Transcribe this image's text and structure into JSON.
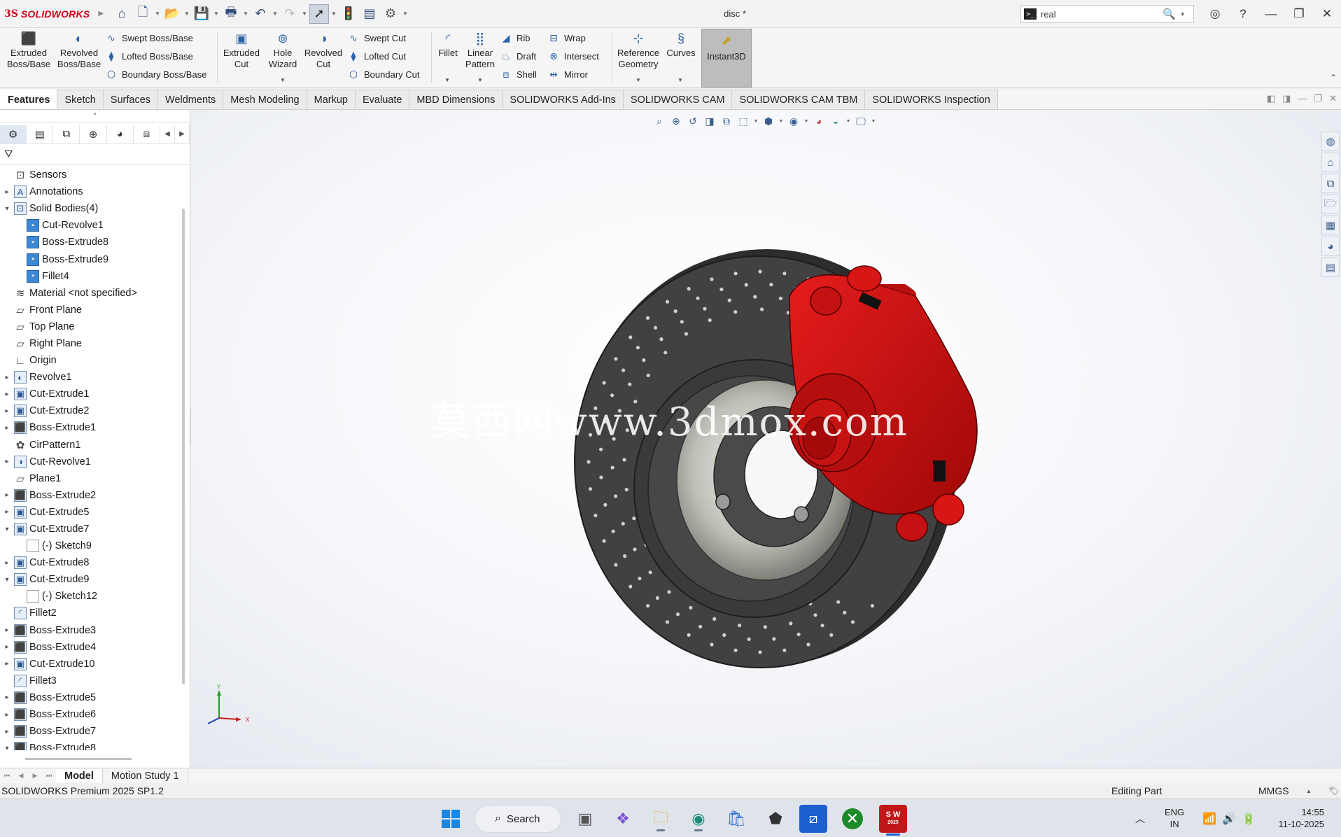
{
  "app": {
    "logo_ds": "3S",
    "logo_text": "SOLIDWORKS",
    "doc_title": "disc *",
    "search_value": "real",
    "search_cmd_icon": ">_"
  },
  "quick_access": [
    {
      "name": "home-icon"
    },
    {
      "name": "new-document-icon"
    },
    {
      "name": "open-icon"
    },
    {
      "name": "save-icon"
    },
    {
      "name": "print-icon"
    },
    {
      "name": "undo-icon"
    },
    {
      "name": "redo-icon"
    },
    {
      "name": "select-icon"
    },
    {
      "name": "rebuild-icon"
    },
    {
      "name": "file-properties-icon"
    },
    {
      "name": "options-icon"
    }
  ],
  "command_manager": {
    "extruded_boss": "Extruded\nBoss/Base",
    "revolved_boss": "Revolved\nBoss/Base",
    "swept_boss": "Swept Boss/Base",
    "lofted_boss": "Lofted Boss/Base",
    "boundary_boss": "Boundary Boss/Base",
    "extruded_cut": "Extruded\nCut",
    "hole_wizard": "Hole\nWizard",
    "revolved_cut": "Revolved\nCut",
    "swept_cut": "Swept Cut",
    "lofted_cut": "Lofted Cut",
    "boundary_cut": "Boundary Cut",
    "fillet": "Fillet",
    "linear_pattern": "Linear\nPattern",
    "rib": "Rib",
    "draft": "Draft",
    "shell": "Shell",
    "wrap": "Wrap",
    "intersect": "Intersect",
    "mirror": "Mirror",
    "reference_geometry": "Reference\nGeometry",
    "curves": "Curves",
    "instant3d": "Instant3D"
  },
  "tabs": [
    "Features",
    "Sketch",
    "Surfaces",
    "Weldments",
    "Mesh Modeling",
    "Markup",
    "Evaluate",
    "MBD Dimensions",
    "SOLIDWORKS Add-Ins",
    "SOLIDWORKS CAM",
    "SOLIDWORKS CAM TBM",
    "SOLIDWORKS Inspection"
  ],
  "active_tab": "Features",
  "feature_tree": [
    {
      "label": "Sensors",
      "icon": "sensor-icon",
      "expand": ""
    },
    {
      "label": "Annotations",
      "icon": "annotations-icon",
      "expand": "▸"
    },
    {
      "label": "Solid Bodies(4)",
      "icon": "solid-bodies-icon",
      "expand": "▾"
    },
    {
      "label": "Cut-Revolve1",
      "icon": "solid-body-icon",
      "expand": "",
      "indent": 1
    },
    {
      "label": "Boss-Extrude8",
      "icon": "solid-body-icon",
      "expand": "",
      "indent": 1
    },
    {
      "label": "Boss-Extrude9",
      "icon": "solid-body-icon",
      "expand": "",
      "indent": 1
    },
    {
      "label": "Fillet4",
      "icon": "solid-body-icon",
      "expand": "",
      "indent": 1
    },
    {
      "label": "Material <not specified>",
      "icon": "material-icon",
      "expand": ""
    },
    {
      "label": "Front Plane",
      "icon": "plane-icon",
      "expand": ""
    },
    {
      "label": "Top Plane",
      "icon": "plane-icon",
      "expand": ""
    },
    {
      "label": "Right Plane",
      "icon": "plane-icon",
      "expand": ""
    },
    {
      "label": "Origin",
      "icon": "origin-icon",
      "expand": ""
    },
    {
      "label": "Revolve1",
      "icon": "revolve-icon",
      "expand": "▸"
    },
    {
      "label": "Cut-Extrude1",
      "icon": "cut-extrude-icon",
      "expand": "▸"
    },
    {
      "label": "Cut-Extrude2",
      "icon": "cut-extrude-icon",
      "expand": "▸"
    },
    {
      "label": "Boss-Extrude1",
      "icon": "boss-extrude-icon",
      "expand": "▸"
    },
    {
      "label": "CirPattern1",
      "icon": "circular-pattern-icon",
      "expand": ""
    },
    {
      "label": "Cut-Revolve1",
      "icon": "cut-revolve-icon",
      "expand": "▸"
    },
    {
      "label": "Plane1",
      "icon": "plane-icon",
      "expand": ""
    },
    {
      "label": "Boss-Extrude2",
      "icon": "boss-extrude-icon",
      "expand": "▸"
    },
    {
      "label": "Cut-Extrude5",
      "icon": "cut-extrude-icon",
      "expand": "▸"
    },
    {
      "label": "Cut-Extrude7",
      "icon": "cut-extrude-icon",
      "expand": "▾"
    },
    {
      "label": "(-) Sketch9",
      "icon": "sketch-icon",
      "expand": "",
      "indent": 1
    },
    {
      "label": "Cut-Extrude8",
      "icon": "cut-extrude-icon",
      "expand": "▸"
    },
    {
      "label": "Cut-Extrude9",
      "icon": "cut-extrude-icon",
      "expand": "▾"
    },
    {
      "label": "(-) Sketch12",
      "icon": "sketch-icon",
      "expand": "",
      "indent": 1
    },
    {
      "label": "Fillet2",
      "icon": "fillet-icon",
      "expand": ""
    },
    {
      "label": "Boss-Extrude3",
      "icon": "boss-extrude-icon",
      "expand": "▸"
    },
    {
      "label": "Boss-Extrude4",
      "icon": "boss-extrude-icon",
      "expand": "▸"
    },
    {
      "label": "Cut-Extrude10",
      "icon": "cut-extrude-icon",
      "expand": "▸"
    },
    {
      "label": "Fillet3",
      "icon": "fillet-icon",
      "expand": ""
    },
    {
      "label": "Boss-Extrude5",
      "icon": "boss-extrude-icon",
      "expand": "▸"
    },
    {
      "label": "Boss-Extrude6",
      "icon": "boss-extrude-icon",
      "expand": "▸"
    },
    {
      "label": "Boss-Extrude7",
      "icon": "boss-extrude-icon",
      "expand": "▸"
    },
    {
      "label": "Boss-Extrude8",
      "icon": "boss-extrude-icon",
      "expand": "▾"
    }
  ],
  "graphics": {
    "watermark": "莫西网www.3dmox.com",
    "triad_y": "Y",
    "triad_x": "X",
    "disc_color": "#404040",
    "caliper_color": "#cc0a0a"
  },
  "bottom_tabs": {
    "model": "Model",
    "motion_study": "Motion Study 1"
  },
  "status": {
    "version": "SOLIDWORKS Premium 2025 SP1.2",
    "mode": "Editing Part",
    "units": "MMGS"
  },
  "taskbar": {
    "search_label": "Search",
    "lang_line1": "ENG",
    "lang_line2": "IN",
    "time": "14:55",
    "date": "11-10-2025",
    "sw_badge": "S W",
    "sw_year": "2025"
  }
}
